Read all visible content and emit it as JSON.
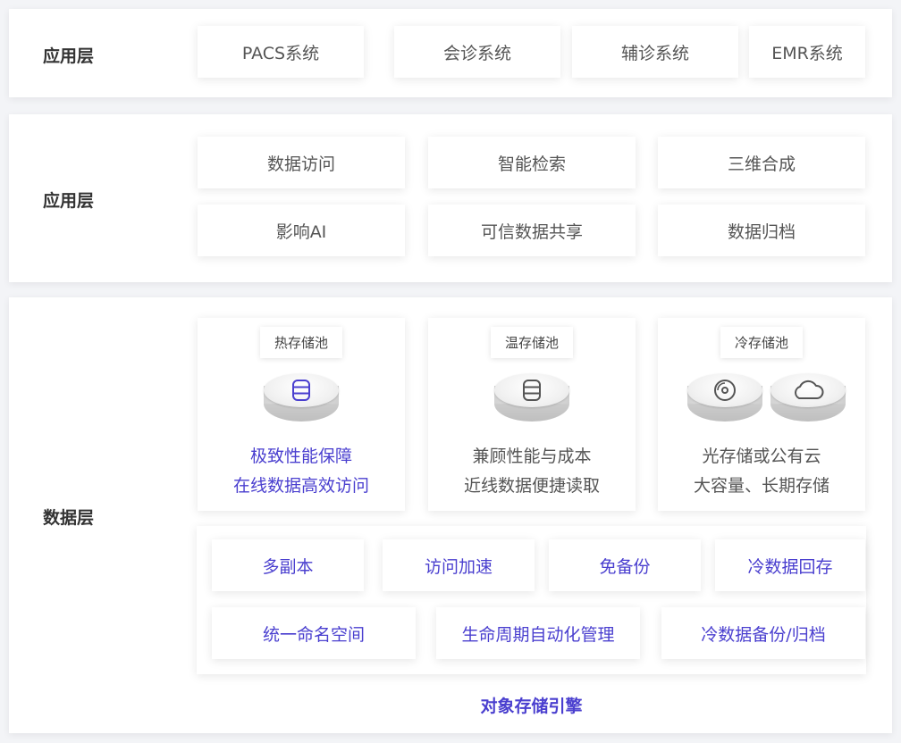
{
  "layers": {
    "app": {
      "title": "应用层",
      "items": [
        "PACS系统",
        "会诊系统",
        "辅诊系统",
        "EMR系统"
      ]
    },
    "service": {
      "title": "应用层",
      "items": [
        "数据访问",
        "智能检索",
        "三维合成",
        "影响AI",
        "可信数据共享",
        "数据归档"
      ]
    },
    "data": {
      "title": "数据层",
      "pools": [
        {
          "tag": "热存储池",
          "line1": "极致性能保障",
          "line2": "在线数据高效访问",
          "icon": "database-icon"
        },
        {
          "tag": "温存储池",
          "line1": "兼顾性能与成本",
          "line2": "近线数据便捷读取",
          "icon": "database-icon"
        },
        {
          "tag": "冷存储池",
          "line1": "光存储或公有云",
          "line2": "大容量、长期存储",
          "icons": [
            "optical-disc-icon",
            "cloud-icon"
          ]
        }
      ],
      "features_row1": [
        "多副本",
        "访问加速",
        "免备份",
        "冷数据回存"
      ],
      "features_row2": [
        "统一命名空间",
        "生命周期自动化管理",
        "冷数据备份/归档"
      ],
      "engine_label": "对象存储引擎"
    }
  },
  "colors": {
    "accent": "#4a3fcf",
    "text": "#555555",
    "background": "#f3f4f7"
  }
}
